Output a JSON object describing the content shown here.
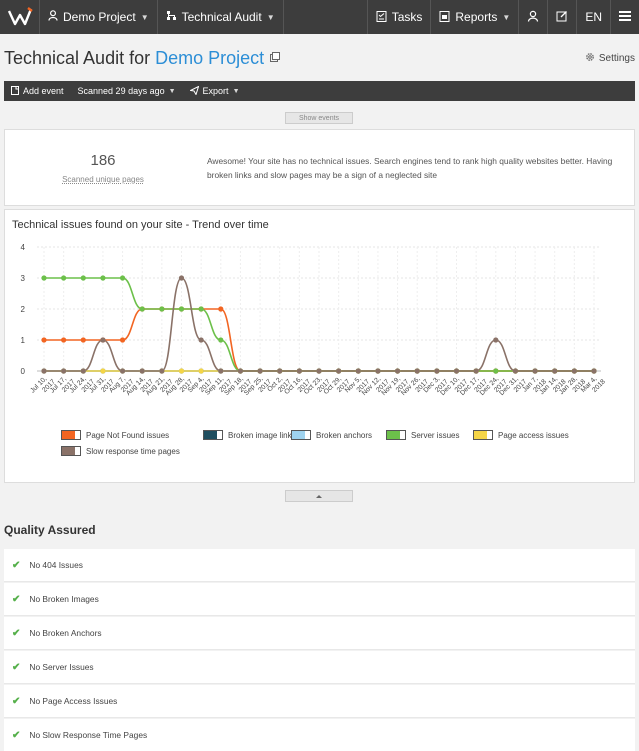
{
  "topbar": {
    "project": "Demo Project",
    "module": "Technical Audit",
    "tasks": "Tasks",
    "reports": "Reports",
    "language": "EN"
  },
  "header": {
    "title": "Technical Audit for",
    "project_link": "Demo Project",
    "settings": "Settings"
  },
  "toolbar": {
    "add_event": "Add event",
    "scanned": "Scanned 29 days ago",
    "export": "Export"
  },
  "show_events": "Show events",
  "summary": {
    "count": "186",
    "count_label": "Scanned unique pages",
    "message": "Awesome! Your site has no technical issues. Search engines tend to rank high quality websites better. Having broken links and slow pages may be a sign of a neglected site"
  },
  "chart_data": {
    "type": "line",
    "title": "Technical issues found on your site - Trend over time",
    "ylim": [
      0,
      4
    ],
    "yticks": [
      "0",
      "1",
      "2",
      "3",
      "4"
    ],
    "x": [
      "Jul 10, 2017",
      "Jul 17, 2017",
      "Jul 24, 2017",
      "Jul 31, 2017",
      "Aug 7, 2017",
      "Aug 14, 2017",
      "Aug 21, 2017",
      "Aug 28, 2017",
      "Sep 4, 2017",
      "Sep 11, 2017",
      "Sep 18, 2017",
      "Sep 25, 2017",
      "Oct 2, 2017",
      "Oct 16, 2017",
      "Oct 23, 2017",
      "Oct 29, 2017",
      "Nov 5, 2017",
      "Nov 12, 2017",
      "Nov 19, 2017",
      "Nov 26, 2017",
      "Dec 3, 2017",
      "Dec 10, 2017",
      "Dec 17, 2017",
      "Dec 24, 2017",
      "Dec 31, 2017",
      "Jan 7, 2018",
      "Jan 14, 2018",
      "Jan 28, 2018",
      "Mar 4, 2018"
    ],
    "series": [
      {
        "name": "Page Not Found issues",
        "color": "#f26522",
        "values": [
          1,
          1,
          1,
          1,
          1,
          2,
          2,
          2,
          2,
          2,
          0,
          0,
          0,
          0,
          0,
          0,
          0,
          0,
          0,
          0,
          0,
          0,
          0,
          0,
          0,
          0,
          0,
          0,
          0
        ]
      },
      {
        "name": "Broken image links",
        "color": "#1f4e5f",
        "values": [
          0,
          0,
          0,
          0,
          0,
          0,
          0,
          0,
          0,
          0,
          0,
          0,
          0,
          0,
          0,
          0,
          0,
          0,
          0,
          0,
          0,
          0,
          0,
          0,
          0,
          0,
          0,
          0,
          0
        ]
      },
      {
        "name": "Broken anchors",
        "color": "#9fd3ef",
        "values": [
          0,
          0,
          0,
          0,
          0,
          0,
          0,
          0,
          0,
          0,
          0,
          0,
          0,
          0,
          0,
          0,
          0,
          0,
          0,
          0,
          0,
          0,
          0,
          0,
          0,
          0,
          0,
          0,
          0
        ]
      },
      {
        "name": "Server issues",
        "color": "#6cc04a",
        "values": [
          3,
          3,
          3,
          3,
          3,
          2,
          2,
          2,
          2,
          1,
          0,
          0,
          0,
          0,
          0,
          0,
          0,
          0,
          0,
          0,
          0,
          0,
          0,
          0,
          0,
          0,
          0,
          0,
          0
        ]
      },
      {
        "name": "Page access issues",
        "color": "#f5d547",
        "values": [
          0,
          0,
          0,
          0,
          0,
          0,
          0,
          0,
          0,
          0,
          0,
          0,
          0,
          0,
          0,
          0,
          0,
          0,
          0,
          0,
          0,
          0,
          0,
          0,
          0,
          0,
          0,
          0,
          0
        ]
      },
      {
        "name": "Slow response time pages",
        "color": "#8a7268",
        "values": [
          0,
          0,
          0,
          1,
          0,
          0,
          0,
          3,
          1,
          0,
          0,
          0,
          0,
          0,
          0,
          0,
          0,
          0,
          0,
          0,
          0,
          0,
          0,
          1,
          0,
          0,
          0,
          0,
          0
        ]
      }
    ],
    "grid": true,
    "legend": "bottom"
  },
  "quality": {
    "title": "Quality Assured",
    "items": [
      "No 404 Issues",
      "No Broken Images",
      "No Broken Anchors",
      "No Server Issues",
      "No Page Access Issues",
      "No Slow Response Time Pages"
    ]
  }
}
